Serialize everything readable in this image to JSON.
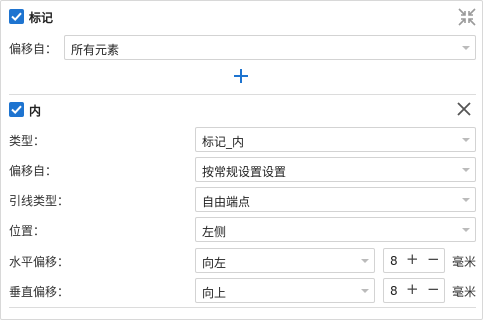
{
  "marker_section": {
    "title": "标记",
    "offset_from_label": "偏移自：",
    "offset_from_value": "所有元素"
  },
  "inner_section": {
    "title": "内",
    "type_label": "类型：",
    "type_value": "标记_内",
    "offset_from_label": "偏移自：",
    "offset_from_value": "按常规设置设置",
    "leader_type_label": "引线类型：",
    "leader_type_value": "自由端点",
    "position_label": "位置：",
    "position_value": "左侧",
    "h_offset_label": "水平偏移：",
    "h_offset_dir": "向左",
    "h_offset_value": "8",
    "v_offset_label": "垂直偏移：",
    "v_offset_dir": "向上",
    "v_offset_value": "8",
    "unit": "毫米"
  },
  "colors": {
    "accent": "#1e74d0"
  }
}
